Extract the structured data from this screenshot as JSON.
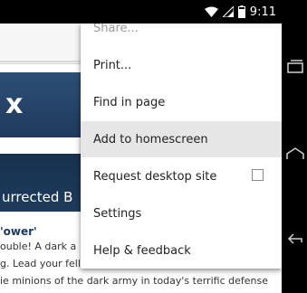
{
  "status_bar": {
    "time": "9:11",
    "icons": [
      "wifi-icon",
      "signal-icon",
      "battery-icon"
    ]
  },
  "page": {
    "hero_top_glyph": "x",
    "hero_bottom_text": "urrected B",
    "article_title": "'ower'",
    "article_lines": [
      "ouble! A dark a",
      "g. Lead your fellow soldiers to victory as they work to",
      "ie minions of the dark army in today's terrific defense"
    ]
  },
  "menu": {
    "items": [
      {
        "label": "Share..."
      },
      {
        "label": "Print..."
      },
      {
        "label": "Find in page"
      },
      {
        "label": "Add to homescreen"
      },
      {
        "label": "Request desktop site",
        "checked": false
      },
      {
        "label": "Settings"
      },
      {
        "label": "Help & feedback"
      }
    ],
    "highlighted_item": "Add to homescreen"
  },
  "nav_bar": {
    "buttons": [
      "recents-icon",
      "home-icon",
      "back-icon"
    ]
  },
  "colors": {
    "hero": "#1f3a5c",
    "menu_highlight": "#e6e6e6",
    "title_blue": "#1b3a63"
  }
}
